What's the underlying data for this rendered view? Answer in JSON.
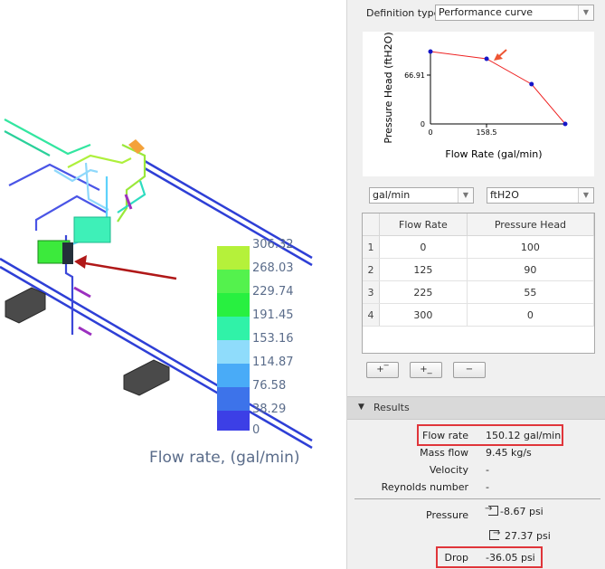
{
  "viewport": {
    "legend": {
      "title": "Flow rate, (gal/min)",
      "labels": [
        "306.32",
        "268.03",
        "229.74",
        "191.45",
        "153.16",
        "114.87",
        "76.58",
        "38.29",
        "0"
      ],
      "colors": [
        "#b5f13a",
        "#54f24d",
        "#28f040",
        "#30f2a8",
        "#8fdcfb",
        "#49abf7",
        "#3d73ea",
        "#3c3fe6"
      ]
    }
  },
  "panel": {
    "definition_type_label": "Definition type",
    "definition_type_value": "Performance curve",
    "chart_data": {
      "type": "line",
      "x": [
        0,
        125,
        225,
        300
      ],
      "y": [
        100,
        90,
        55,
        0
      ],
      "xlabel": "Flow Rate (gal/min)",
      "ylabel": "Pressure Head (ftH2O)",
      "x_ticks": [
        "0",
        "158.5"
      ],
      "y_ticks": [
        "0",
        "66.91"
      ],
      "xlim": [
        0,
        300
      ],
      "ylim": [
        0,
        100
      ],
      "line_color": "#ee2222",
      "point_color": "#1515c8",
      "marker_color": "#ee5533"
    },
    "units": {
      "flow": "gal/min",
      "head": "ftH2O"
    },
    "table": {
      "headers": [
        "Flow Rate",
        "Pressure Head"
      ],
      "rows": [
        {
          "idx": "1",
          "flow": "0",
          "head": "100"
        },
        {
          "idx": "2",
          "flow": "125",
          "head": "90"
        },
        {
          "idx": "3",
          "flow": "225",
          "head": "55"
        },
        {
          "idx": "4",
          "flow": "300",
          "head": "0"
        }
      ]
    },
    "buttons": {
      "add_above": "+‾",
      "add_below": "+_",
      "remove": "−"
    },
    "results": {
      "header": "Results",
      "flow_rate_label": "Flow rate",
      "flow_rate_value": "150.12 gal/min",
      "mass_flow_label": "Mass flow",
      "mass_flow_value": "9.45 kg/s",
      "velocity_label": "Velocity",
      "velocity_value": "-",
      "reynolds_label": "Reynolds number",
      "reynolds_value": "-",
      "pressure_label": "Pressure",
      "pressure_in_value": "-8.67 psi",
      "pressure_out_value": "27.37 psi",
      "drop_label": "Drop",
      "drop_value": "-36.05 psi",
      "highlight_color": "#e0353a"
    }
  }
}
